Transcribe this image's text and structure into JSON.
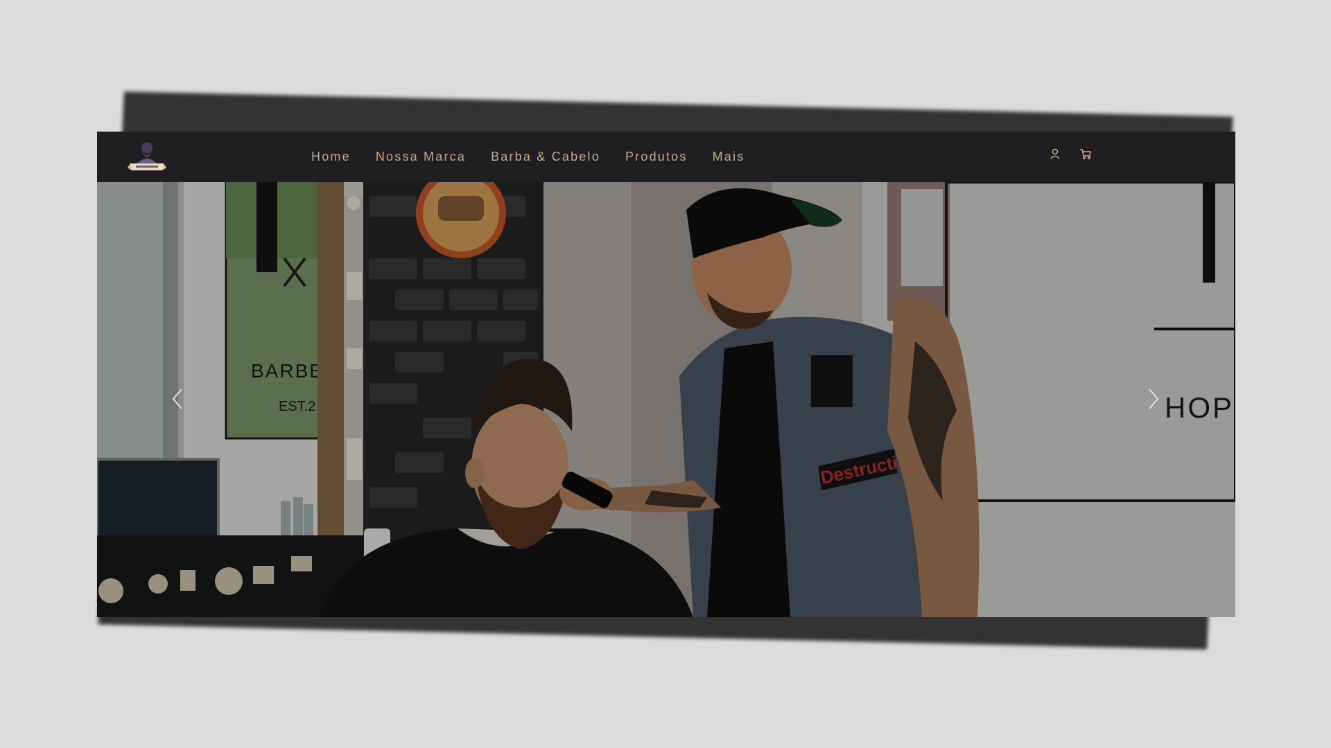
{
  "nav": {
    "logo_name": "barber-shop-logo",
    "links": [
      "Home",
      "Nossa Marca",
      "Barba & Cabelo",
      "Produtos",
      "Mais"
    ],
    "account_icon": "user-icon",
    "cart_icon": "cart-icon"
  },
  "hero": {
    "prev_icon": "chevron-left-icon",
    "next_icon": "chevron-right-icon",
    "window_sign": "BARBER",
    "window_sign_sub": "EST.2",
    "right_sign": "HOP",
    "patch_text": "Destruction"
  },
  "colors": {
    "page_background": "#dcdcdc",
    "nav_background": "#1f1f21",
    "nav_text": "#c8a98a",
    "icon_color": "#c8a98a"
  }
}
